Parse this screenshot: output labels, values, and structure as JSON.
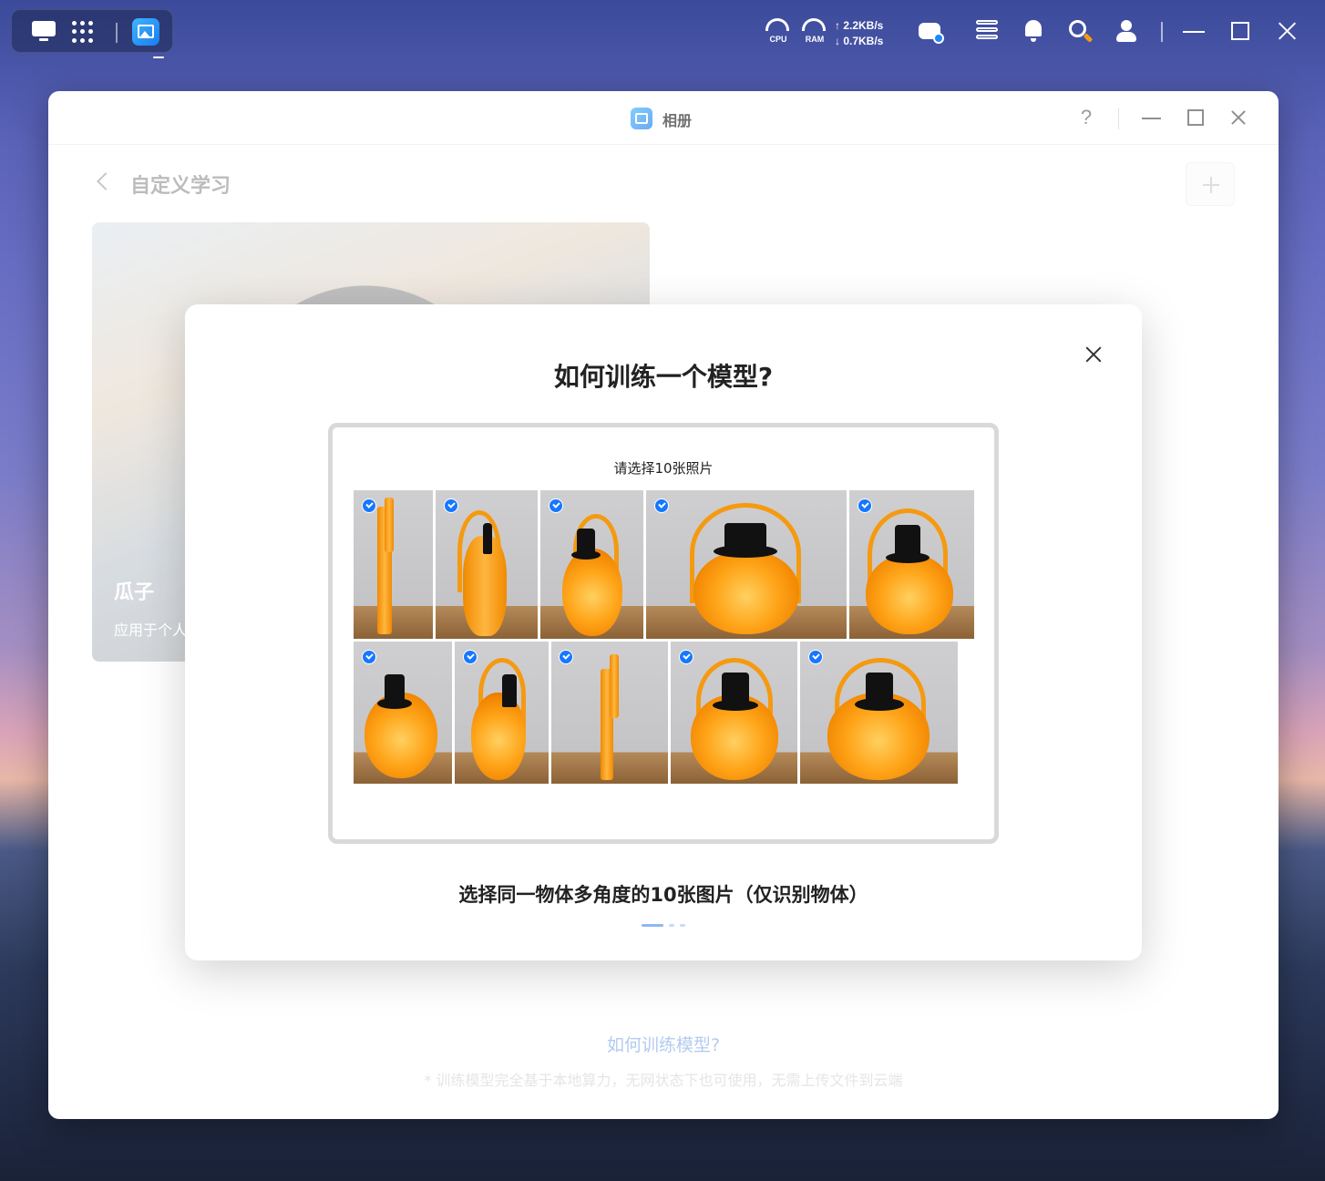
{
  "taskbar": {
    "cpu_label": "CPU",
    "ram_label": "RAM",
    "upload_speed": "↑ 2.2KB/s",
    "download_speed": "↓ 0.7KB/s"
  },
  "window": {
    "title": "相册",
    "help_label": "?"
  },
  "page": {
    "title": "自定义学习",
    "card": {
      "name": "瓜子",
      "description": "应用于个人"
    },
    "footer_link": "如何训练模型?",
    "footer_note": "* 训练模型完全基于本地算力，无网状态下也可使用，无需上传文件到云端"
  },
  "modal": {
    "title": "如何训练一个模型?",
    "illustration_title": "请选择10张照片",
    "caption": "选择同一物体多角度的10张图片（仅识别物体）",
    "selected_photos": 10,
    "current_step": 1,
    "total_steps": 3
  },
  "colors": {
    "accent": "#1677ff",
    "pumpkin": "#ffa418"
  }
}
